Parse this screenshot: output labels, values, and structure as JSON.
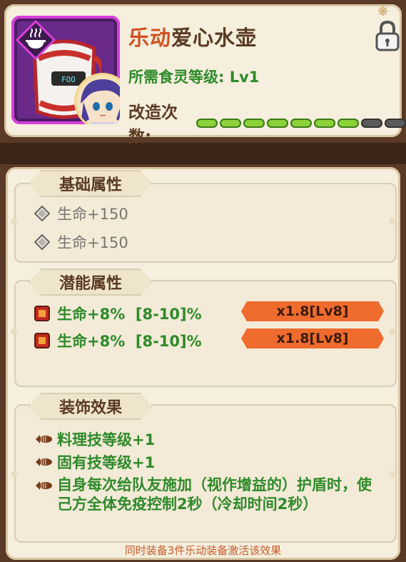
{
  "item": {
    "name_highlight": "乐动",
    "name_rest": "爱心水壶",
    "required_label": "所需食灵等级:",
    "required_value": "Lv1",
    "refine_label": "改造次数:",
    "refine_filled": 7,
    "refine_total": 9,
    "kettle_display": "FOO"
  },
  "icons": {
    "badge": "steaming-bowl-icon",
    "lock": "padlock-icon",
    "gem_grey": "grey-diamond-gem-icon",
    "gem_red": "red-gem-icon",
    "bullet": "fish-bullet-icon"
  },
  "sections": {
    "basic": {
      "title": "基础属性",
      "stats": [
        {
          "text": "生命+150"
        },
        {
          "text": "生命+150"
        }
      ]
    },
    "potential": {
      "title": "潜能属性",
      "stats": [
        {
          "text": "生命+8%  [8-10]%",
          "tag": "x1.8[Lv8]"
        },
        {
          "text": "生命+8%  [8-10]%",
          "tag": "x1.8[Lv8]"
        }
      ]
    },
    "decor": {
      "title": "装饰效果",
      "cut_line": "……",
      "effects": [
        "料理技等级+1",
        "固有技等级+1",
        "自身每次给队友施加（视作增益的）护盾时，使己方全体免疫控制2秒（冷却时间2秒）"
      ],
      "footer": "同时装备3件乐动装备激活该效果"
    }
  },
  "colors": {
    "highlight": "#d2501f",
    "green": "#2e8a2a",
    "tag": "#ef6b2e",
    "panel": "#f6efdd"
  }
}
